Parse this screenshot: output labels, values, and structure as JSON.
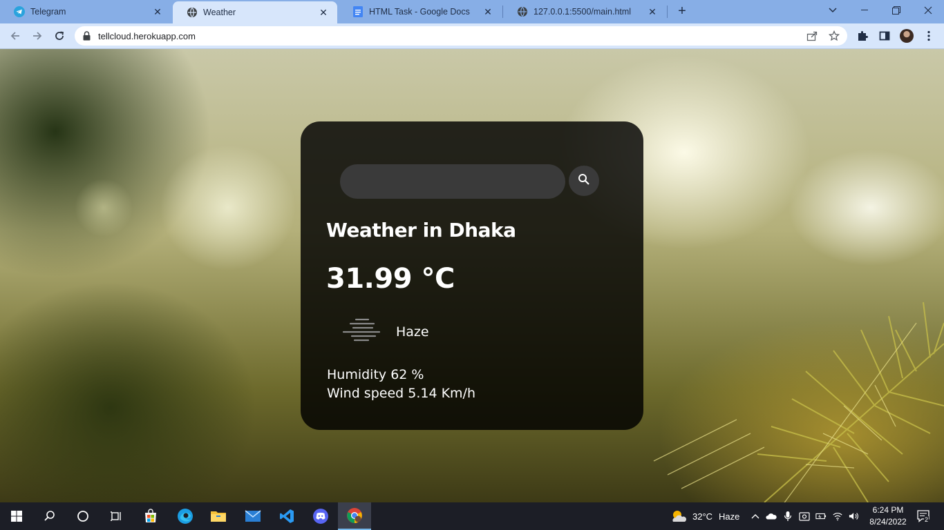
{
  "browser": {
    "tabs": [
      {
        "label": "Telegram",
        "icon": "telegram-icon",
        "active": false
      },
      {
        "label": "Weather",
        "icon": "globe-icon",
        "active": true
      },
      {
        "label": "HTML Task - Google Docs",
        "icon": "docs-icon",
        "active": false
      },
      {
        "label": "127.0.0.1:5500/main.html",
        "icon": "globe-icon",
        "active": false
      }
    ],
    "url": "tellcloud.herokuapp.com"
  },
  "weather": {
    "search_placeholder": "",
    "title": "Weather in Dhaka",
    "temperature": "31.99 °C",
    "description": "Haze",
    "humidity": "Humidity 62 %",
    "wind": "Wind speed 5.14 Km/h"
  },
  "taskbar": {
    "weather_temp": "32°C",
    "weather_desc": "Haze",
    "time": "6:24 PM",
    "date": "8/24/2022",
    "notification_count": "2"
  },
  "colors": {
    "tabstrip": "#87aee6",
    "toolbar": "#d7e6fb",
    "card_background": "#000000d1",
    "taskbar": "#1c1e26"
  }
}
